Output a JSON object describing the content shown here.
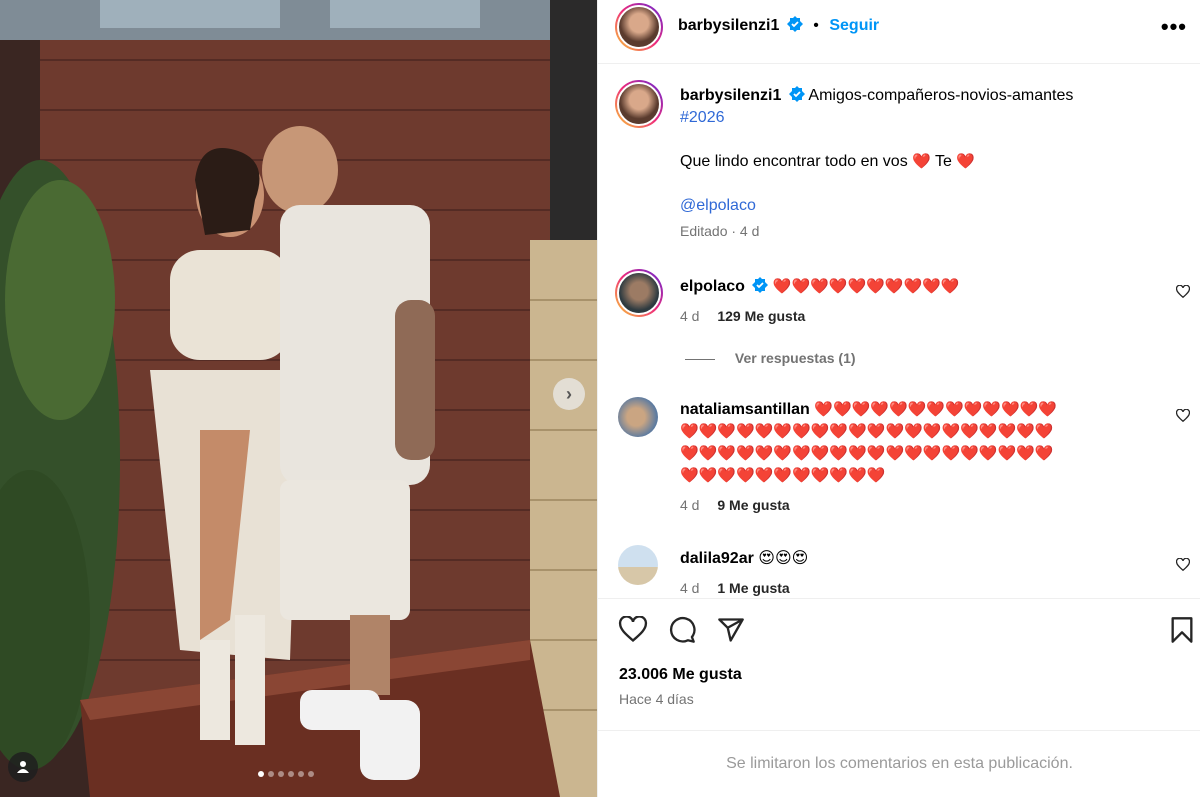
{
  "post": {
    "author": "barbysilenzi1",
    "follow_label": "Seguir",
    "more_label": "•••",
    "caption_line1": "Amigos-compañeros-novios-amantes",
    "hashtag": "#2026",
    "caption_line2": "Que lindo encontrar todo en vos",
    "caption_heart": "❤️",
    "caption_te": "Te",
    "mention": "@elpolaco",
    "edited": "Editado · 4 d"
  },
  "photo": {
    "carousel_next": "›",
    "dots": [
      true,
      false,
      false,
      false,
      false,
      false
    ]
  },
  "comments": [
    {
      "user": "elpolaco",
      "verified": true,
      "text": "❤️❤️❤️❤️❤️❤️❤️❤️❤️❤️",
      "age": "4 d",
      "likes": "129 Me gusta",
      "replies": "Ver respuestas (1)"
    },
    {
      "user": "nataliamsantillan",
      "verified": false,
      "line1": "❤️❤️❤️❤️❤️❤️❤️❤️❤️❤️❤️❤️❤️",
      "line2": "❤️❤️❤️❤️❤️❤️❤️❤️❤️❤️❤️❤️❤️❤️❤️❤️❤️❤️❤️❤️",
      "line3": "❤️❤️❤️❤️❤️❤️❤️❤️❤️❤️❤️❤️❤️❤️❤️❤️❤️❤️❤️❤️",
      "line4": "❤️❤️❤️❤️❤️❤️❤️❤️❤️❤️❤️",
      "age": "4 d",
      "likes": "9 Me gusta"
    },
    {
      "user": "dalila92ar",
      "verified": false,
      "text": "😍😍😍",
      "age": "4 d",
      "likes": "1 Me gusta"
    }
  ],
  "footer": {
    "likes": "23.006 Me gusta",
    "when": "Hace 4 días",
    "limited": "Se limitaron los comentarios en esta publicación."
  },
  "icons": [
    "heart-icon",
    "comment-icon",
    "share-icon",
    "bookmark-icon",
    "verified-icon",
    "user-tag-icon"
  ],
  "colors": {
    "accent": "#0095f6",
    "heart": "#ed4956",
    "muted": "#737373"
  }
}
